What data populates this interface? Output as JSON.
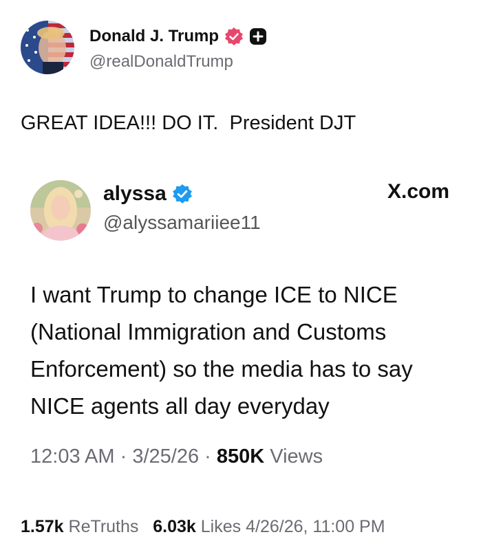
{
  "post": {
    "author": {
      "display_name": "Donald J. Trump",
      "handle": "@realDonaldTrump",
      "verified_badge_color": "#e8476c",
      "plus_badge_color": "#111111"
    },
    "text": "GREAT IDEA!!! DO IT.  President DJT"
  },
  "quoted_post": {
    "author": {
      "display_name": "alyssa",
      "handle": "@alyssamariiee11",
      "verified_badge_color": "#1d9bf0"
    },
    "source": "X.com",
    "text": "I want Trump to change ICE to NICE (National Immigration and Customs Enforcement) so the media has to say NICE agents all day everyday",
    "time": "12:03 AM",
    "separator": "·",
    "date": "3/25/26",
    "views_count": "850K",
    "views_label": "Views"
  },
  "stats": {
    "retruths_count": "1.57k",
    "retruths_label": "ReTruths",
    "likes_count": "6.03k",
    "likes_label": "Likes",
    "timestamp": "4/26/26, 11:00 PM"
  }
}
